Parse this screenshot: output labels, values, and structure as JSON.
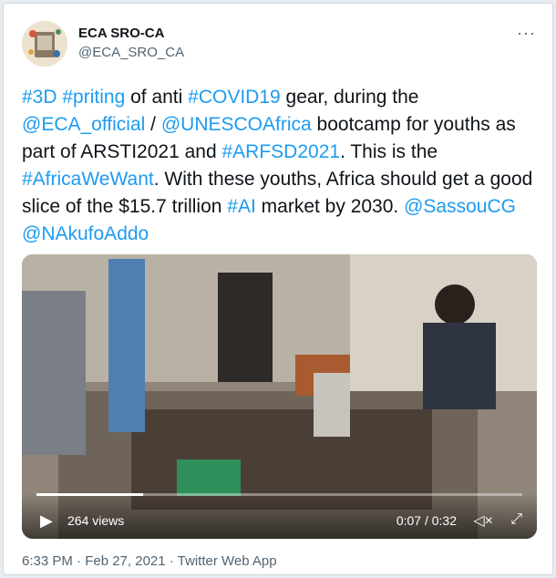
{
  "author": {
    "name": "ECA SRO-CA",
    "handle": "@ECA_SRO_CA"
  },
  "tweet": {
    "segments": [
      {
        "t": "#3D",
        "link": true
      },
      {
        "t": " ",
        "link": false
      },
      {
        "t": "#priting",
        "link": true
      },
      {
        "t": " of anti ",
        "link": false
      },
      {
        "t": "#COVID19",
        "link": true
      },
      {
        "t": " gear, during the ",
        "link": false
      },
      {
        "t": "@ECA_official",
        "link": true
      },
      {
        "t": " / ",
        "link": false
      },
      {
        "t": "@UNESCOAfrica",
        "link": true
      },
      {
        "t": " bootcamp for youths as part of ARSTI2021 and ",
        "link": false
      },
      {
        "t": "#ARFSD2021",
        "link": true
      },
      {
        "t": ". This is the ",
        "link": false
      },
      {
        "t": "#AfricaWeWant",
        "link": true
      },
      {
        "t": ". With these youths, Africa should get a good slice of the $15.7 trillion ",
        "link": false
      },
      {
        "t": "#AI",
        "link": true
      },
      {
        "t": " market by 2030. ",
        "link": false
      },
      {
        "t": "@SassouCG",
        "link": true
      },
      {
        "t": " ",
        "link": false
      },
      {
        "t": "@NAkufoAddo",
        "link": true
      }
    ]
  },
  "video": {
    "views": "264 views",
    "time": "0:07 / 0:32",
    "progress": 0.22
  },
  "footer": "6:33 PM · Feb 27, 2021 · Twitter Web App",
  "icons": {
    "more": "more-icon",
    "play": "play-icon",
    "mute": "mute-icon",
    "fullscreen": "fullscreen-icon"
  }
}
